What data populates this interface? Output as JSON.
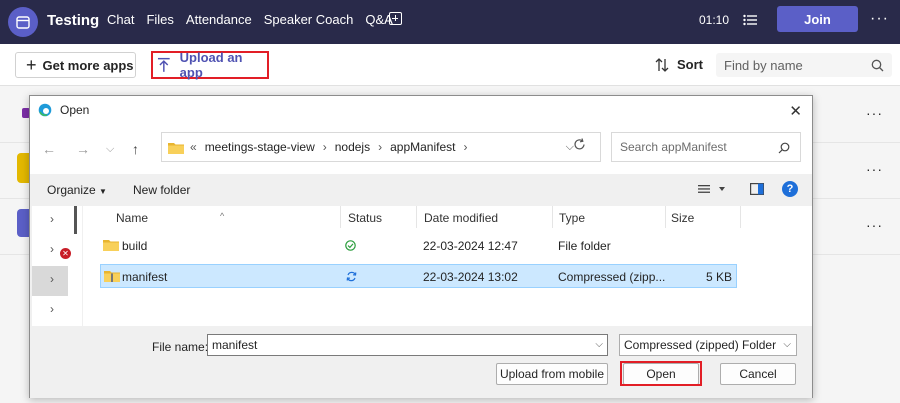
{
  "teams": {
    "meeting_title": "Testing",
    "tabs": [
      "Chat",
      "Files",
      "Attendance",
      "Speaker Coach",
      "Q&A"
    ],
    "timer": "01:10",
    "join_label": "Join",
    "more": "···",
    "accent": "#5b5fc7",
    "bar_color": "#292a4a"
  },
  "toolbar": {
    "get_more_apps": "Get more apps",
    "upload_app": "Upload an app",
    "sort": "Sort",
    "find_placeholder": "Find by name",
    "highlight_color": "#e21e26"
  },
  "dialog": {
    "title": "Open",
    "path": [
      "meetings-stage-view",
      "nodejs",
      "appManifest"
    ],
    "path_prefix": "«",
    "search_placeholder": "Search appManifest",
    "organize": "Organize",
    "new_folder": "New folder",
    "help": "?",
    "columns": [
      "Name",
      "Status",
      "Date modified",
      "Type",
      "Size"
    ],
    "files": [
      {
        "name": "build",
        "status_icon": "synced-check-icon",
        "date": "22-03-2024 12:47",
        "type": "File folder",
        "size": ""
      },
      {
        "name": "manifest",
        "status_icon": "sync-pending-icon",
        "date": "22-03-2024 13:02",
        "type": "Compressed (zipp...",
        "size": "5 KB"
      }
    ],
    "file_name_label": "File name:",
    "file_name_value": "manifest",
    "file_type": "Compressed (zipped) Folder",
    "upload_mobile": "Upload from mobile",
    "open": "Open",
    "cancel": "Cancel"
  }
}
